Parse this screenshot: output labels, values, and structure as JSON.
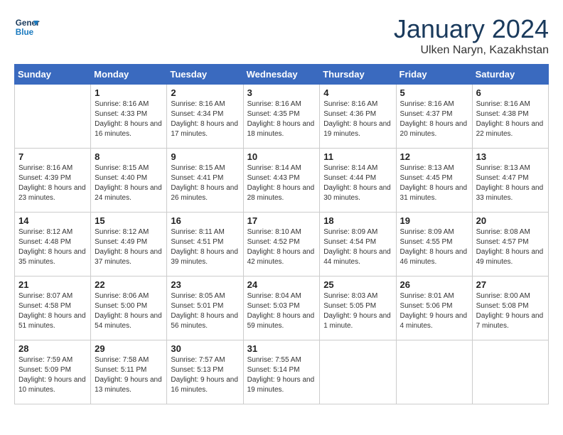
{
  "header": {
    "logo_general": "General",
    "logo_blue": "Blue",
    "month_title": "January 2024",
    "location": "Ulken Naryn, Kazakhstan"
  },
  "days_of_week": [
    "Sunday",
    "Monday",
    "Tuesday",
    "Wednesday",
    "Thursday",
    "Friday",
    "Saturday"
  ],
  "weeks": [
    [
      {
        "day": "",
        "info": ""
      },
      {
        "day": "1",
        "info": "Sunrise: 8:16 AM\nSunset: 4:33 PM\nDaylight: 8 hours\nand 16 minutes."
      },
      {
        "day": "2",
        "info": "Sunrise: 8:16 AM\nSunset: 4:34 PM\nDaylight: 8 hours\nand 17 minutes."
      },
      {
        "day": "3",
        "info": "Sunrise: 8:16 AM\nSunset: 4:35 PM\nDaylight: 8 hours\nand 18 minutes."
      },
      {
        "day": "4",
        "info": "Sunrise: 8:16 AM\nSunset: 4:36 PM\nDaylight: 8 hours\nand 19 minutes."
      },
      {
        "day": "5",
        "info": "Sunrise: 8:16 AM\nSunset: 4:37 PM\nDaylight: 8 hours\nand 20 minutes."
      },
      {
        "day": "6",
        "info": "Sunrise: 8:16 AM\nSunset: 4:38 PM\nDaylight: 8 hours\nand 22 minutes."
      }
    ],
    [
      {
        "day": "7",
        "info": "Daylight: 8 hours\nand 23 minutes."
      },
      {
        "day": "8",
        "info": "Sunrise: 8:15 AM\nSunset: 4:40 PM\nDaylight: 8 hours\nand 24 minutes."
      },
      {
        "day": "9",
        "info": "Sunrise: 8:15 AM\nSunset: 4:41 PM\nDaylight: 8 hours\nand 26 minutes."
      },
      {
        "day": "10",
        "info": "Sunrise: 8:14 AM\nSunset: 4:43 PM\nDaylight: 8 hours\nand 28 minutes."
      },
      {
        "day": "11",
        "info": "Sunrise: 8:14 AM\nSunset: 4:44 PM\nDaylight: 8 hours\nand 30 minutes."
      },
      {
        "day": "12",
        "info": "Sunrise: 8:13 AM\nSunset: 4:45 PM\nDaylight: 8 hours\nand 31 minutes."
      },
      {
        "day": "13",
        "info": "Sunrise: 8:13 AM\nSunset: 4:47 PM\nDaylight: 8 hours\nand 33 minutes."
      }
    ],
    [
      {
        "day": "14",
        "info": "Daylight: 8 hours\nand 35 minutes."
      },
      {
        "day": "15",
        "info": "Sunrise: 8:12 AM\nSunset: 4:49 PM\nDaylight: 8 hours\nand 37 minutes."
      },
      {
        "day": "16",
        "info": "Sunrise: 8:11 AM\nSunset: 4:51 PM\nDaylight: 8 hours\nand 39 minutes."
      },
      {
        "day": "17",
        "info": "Sunrise: 8:10 AM\nSunset: 4:52 PM\nDaylight: 8 hours\nand 42 minutes."
      },
      {
        "day": "18",
        "info": "Sunrise: 8:09 AM\nSunset: 4:54 PM\nDaylight: 8 hours\nand 44 minutes."
      },
      {
        "day": "19",
        "info": "Sunrise: 8:09 AM\nSunset: 4:55 PM\nDaylight: 8 hours\nand 46 minutes."
      },
      {
        "day": "20",
        "info": "Sunrise: 8:08 AM\nSunset: 4:57 PM\nDaylight: 8 hours\nand 49 minutes."
      }
    ],
    [
      {
        "day": "21",
        "info": "Daylight: 8 hours\nand 51 minutes."
      },
      {
        "day": "22",
        "info": "Sunrise: 8:06 AM\nSunset: 5:00 PM\nDaylight: 8 hours\nand 54 minutes."
      },
      {
        "day": "23",
        "info": "Sunrise: 8:05 AM\nSunset: 5:01 PM\nDaylight: 8 hours\nand 56 minutes."
      },
      {
        "day": "24",
        "info": "Sunrise: 8:04 AM\nSunset: 5:03 PM\nDaylight: 8 hours\nand 59 minutes."
      },
      {
        "day": "25",
        "info": "Sunrise: 8:03 AM\nSunset: 5:05 PM\nDaylight: 9 hours\nand 1 minute."
      },
      {
        "day": "26",
        "info": "Sunrise: 8:01 AM\nSunset: 5:06 PM\nDaylight: 9 hours\nand 4 minutes."
      },
      {
        "day": "27",
        "info": "Sunrise: 8:00 AM\nSunset: 5:08 PM\nDaylight: 9 hours\nand 7 minutes."
      }
    ],
    [
      {
        "day": "28",
        "info": "Sunrise: 7:59 AM\nSunset: 5:09 PM\nDaylight: 9 hours\nand 10 minutes."
      },
      {
        "day": "29",
        "info": "Sunrise: 7:58 AM\nSunset: 5:11 PM\nDaylight: 9 hours\nand 13 minutes."
      },
      {
        "day": "30",
        "info": "Sunrise: 7:57 AM\nSunset: 5:13 PM\nDaylight: 9 hours\nand 16 minutes."
      },
      {
        "day": "31",
        "info": "Sunrise: 7:55 AM\nSunset: 5:14 PM\nDaylight: 9 hours\nand 19 minutes."
      },
      {
        "day": "",
        "info": ""
      },
      {
        "day": "",
        "info": ""
      },
      {
        "day": "",
        "info": ""
      }
    ]
  ],
  "week7_sunday": {
    "day": "7",
    "full_info": "Sunrise: 8:16 AM\nSunset: 4:39 PM\nDaylight: 8 hours\nand 23 minutes."
  },
  "week14_sunday": {
    "day": "14",
    "full_info": "Sunrise: 8:12 AM\nSunset: 4:48 PM\nDaylight: 8 hours\nand 35 minutes."
  },
  "week21_sunday": {
    "day": "21",
    "full_info": "Sunrise: 8:07 AM\nSunset: 4:58 PM\nDaylight: 8 hours\nand 51 minutes."
  }
}
